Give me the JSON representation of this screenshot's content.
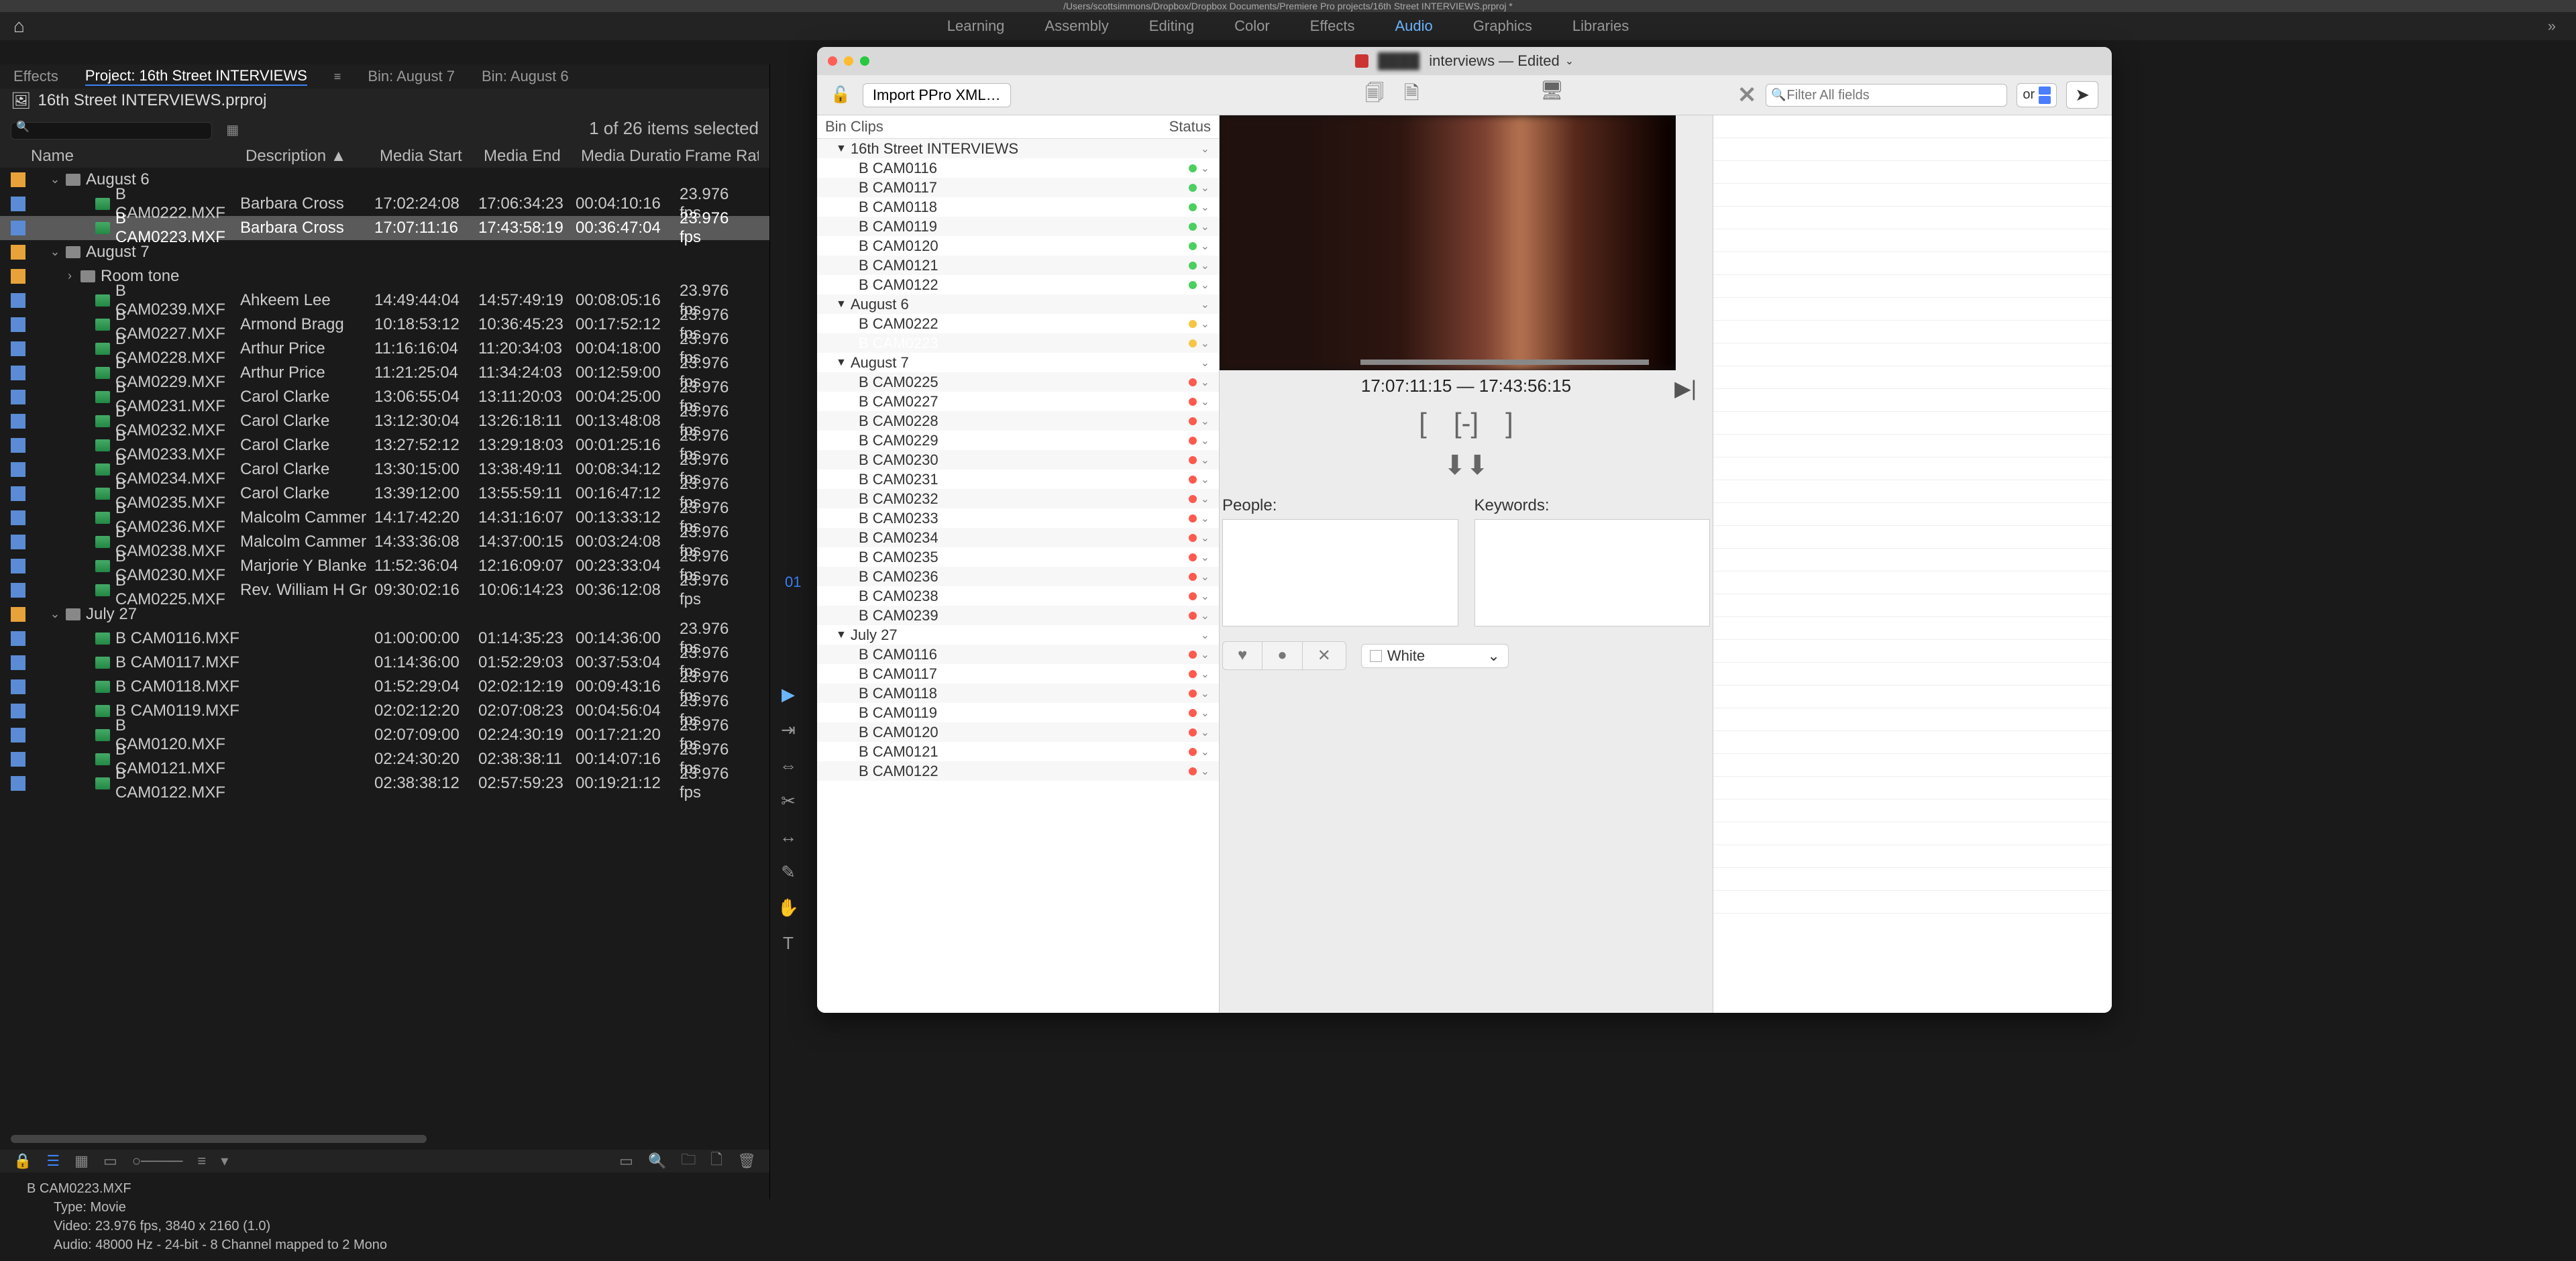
{
  "titlebar": "/Users/scottsimmons/Dropbox/Dropbox Documents/Premiere Pro projects/16th Street INTERVIEWS.prproj *",
  "workspaces": [
    "Learning",
    "Assembly",
    "Editing",
    "Color",
    "Effects",
    "Audio",
    "Graphics",
    "Libraries"
  ],
  "tabs": {
    "effects": "Effects",
    "project": "Project: 16th Street INTERVIEWS",
    "bin1": "Bin: August 7",
    "bin2": "Bin: August 6",
    "effR": "Effe"
  },
  "projectTitle": "16th Street INTERVIEWS.prproj",
  "selCount": "1 of 26 items selected",
  "columns": {
    "name": "Name",
    "desc": "Description ▲",
    "ms": "Media Start",
    "me": "Media End",
    "md": "Media Duratio",
    "fr": "Frame Rat"
  },
  "rows": [
    {
      "t": "folder",
      "ind": 1,
      "name": "August 6"
    },
    {
      "t": "clip",
      "ind": 3,
      "name": "B CAM0222.MXF",
      "desc": "Barbara Cross",
      "ms": "17:02:24:08",
      "me": "17:06:34:23",
      "md": "00:04:10:16",
      "fr": "23.976 fps"
    },
    {
      "t": "clip",
      "ind": 3,
      "name": "B CAM0223.MXF",
      "desc": "Barbara Cross",
      "ms": "17:07:11:16",
      "me": "17:43:58:19",
      "md": "00:36:47:04",
      "fr": "23.976 fps",
      "sel": true
    },
    {
      "t": "folder",
      "ind": 1,
      "name": "August 7"
    },
    {
      "t": "folder",
      "ind": 2,
      "name": "Room tone",
      "closed": true
    },
    {
      "t": "clip",
      "ind": 3,
      "name": "B CAM0239.MXF",
      "desc": "Ahkeem Lee",
      "ms": "14:49:44:04",
      "me": "14:57:49:19",
      "md": "00:08:05:16",
      "fr": "23.976 fps"
    },
    {
      "t": "clip",
      "ind": 3,
      "name": "B CAM0227.MXF",
      "desc": "Armond Bragg",
      "ms": "10:18:53:12",
      "me": "10:36:45:23",
      "md": "00:17:52:12",
      "fr": "23.976 fps"
    },
    {
      "t": "clip",
      "ind": 3,
      "name": "B CAM0228.MXF",
      "desc": "Arthur Price",
      "ms": "11:16:16:04",
      "me": "11:20:34:03",
      "md": "00:04:18:00",
      "fr": "23.976 fps"
    },
    {
      "t": "clip",
      "ind": 3,
      "name": "B CAM0229.MXF",
      "desc": "Arthur Price",
      "ms": "11:21:25:04",
      "me": "11:34:24:03",
      "md": "00:12:59:00",
      "fr": "23.976 fps"
    },
    {
      "t": "clip",
      "ind": 3,
      "name": "B CAM0231.MXF",
      "desc": "Carol Clarke",
      "ms": "13:06:55:04",
      "me": "13:11:20:03",
      "md": "00:04:25:00",
      "fr": "23.976 fps"
    },
    {
      "t": "clip",
      "ind": 3,
      "name": "B CAM0232.MXF",
      "desc": "Carol Clarke",
      "ms": "13:12:30:04",
      "me": "13:26:18:11",
      "md": "00:13:48:08",
      "fr": "23.976 fps"
    },
    {
      "t": "clip",
      "ind": 3,
      "name": "B CAM0233.MXF",
      "desc": "Carol Clarke",
      "ms": "13:27:52:12",
      "me": "13:29:18:03",
      "md": "00:01:25:16",
      "fr": "23.976 fps"
    },
    {
      "t": "clip",
      "ind": 3,
      "name": "B CAM0234.MXF",
      "desc": "Carol Clarke",
      "ms": "13:30:15:00",
      "me": "13:38:49:11",
      "md": "00:08:34:12",
      "fr": "23.976 fps"
    },
    {
      "t": "clip",
      "ind": 3,
      "name": "B CAM0235.MXF",
      "desc": "Carol Clarke",
      "ms": "13:39:12:00",
      "me": "13:55:59:11",
      "md": "00:16:47:12",
      "fr": "23.976 fps"
    },
    {
      "t": "clip",
      "ind": 3,
      "name": "B CAM0236.MXF",
      "desc": "Malcolm Cammer",
      "ms": "14:17:42:20",
      "me": "14:31:16:07",
      "md": "00:13:33:12",
      "fr": "23.976 fps"
    },
    {
      "t": "clip",
      "ind": 3,
      "name": "B CAM0238.MXF",
      "desc": "Malcolm Cammer",
      "ms": "14:33:36:08",
      "me": "14:37:00:15",
      "md": "00:03:24:08",
      "fr": "23.976 fps"
    },
    {
      "t": "clip",
      "ind": 3,
      "name": "B CAM0230.MXF",
      "desc": "Marjorie Y Blanke",
      "ms": "11:52:36:04",
      "me": "12:16:09:07",
      "md": "00:23:33:04",
      "fr": "23.976 fps"
    },
    {
      "t": "clip",
      "ind": 3,
      "name": "B CAM0225.MXF",
      "desc": "Rev. William H Gr",
      "ms": "09:30:02:16",
      "me": "10:06:14:23",
      "md": "00:36:12:08",
      "fr": "23.976 fps"
    },
    {
      "t": "folder",
      "ind": 1,
      "name": "July 27"
    },
    {
      "t": "clip",
      "ind": 3,
      "name": "B CAM0116.MXF",
      "desc": "",
      "ms": "01:00:00:00",
      "me": "01:14:35:23",
      "md": "00:14:36:00",
      "fr": "23.976 fps"
    },
    {
      "t": "clip",
      "ind": 3,
      "name": "B CAM0117.MXF",
      "desc": "",
      "ms": "01:14:36:00",
      "me": "01:52:29:03",
      "md": "00:37:53:04",
      "fr": "23.976 fps"
    },
    {
      "t": "clip",
      "ind": 3,
      "name": "B CAM0118.MXF",
      "desc": "",
      "ms": "01:52:29:04",
      "me": "02:02:12:19",
      "md": "00:09:43:16",
      "fr": "23.976 fps"
    },
    {
      "t": "clip",
      "ind": 3,
      "name": "B CAM0119.MXF",
      "desc": "",
      "ms": "02:02:12:20",
      "me": "02:07:08:23",
      "md": "00:04:56:04",
      "fr": "23.976 fps"
    },
    {
      "t": "clip",
      "ind": 3,
      "name": "B CAM0120.MXF",
      "desc": "",
      "ms": "02:07:09:00",
      "me": "02:24:30:19",
      "md": "00:17:21:20",
      "fr": "23.976 fps"
    },
    {
      "t": "clip",
      "ind": 3,
      "name": "B CAM0121.MXF",
      "desc": "",
      "ms": "02:24:30:20",
      "me": "02:38:38:11",
      "md": "00:14:07:16",
      "fr": "23.976 fps"
    },
    {
      "t": "clip",
      "ind": 3,
      "name": "B CAM0122.MXF",
      "desc": "",
      "ms": "02:38:38:12",
      "me": "02:57:59:23",
      "md": "00:19:21:12",
      "fr": "23.976 fps"
    }
  ],
  "meta": {
    "file": "B CAM0223.MXF",
    "type": "Type:  Movie",
    "video": "Video:  23.976 fps, 3840 x 2160 (1.0)",
    "audio": "Audio:  48000 Hz - 24-bit - 8 Channel mapped to 2 Mono"
  },
  "tlTimecode": "01",
  "overlay": {
    "title": "interviews — Edited",
    "importBtn": "Import PPro XML…",
    "searchPH": "Filter All fields",
    "or": "or",
    "listHdr": {
      "l": "Bin Clips",
      "r": "Status"
    },
    "tree": [
      {
        "t": "h",
        "label": "16th Street INTERVIEWS"
      },
      {
        "t": "c",
        "label": "B CAM0116",
        "dot": "g"
      },
      {
        "t": "c",
        "label": "B CAM0117",
        "dot": "g"
      },
      {
        "t": "c",
        "label": "B CAM0118",
        "dot": "g"
      },
      {
        "t": "c",
        "label": "B CAM0119",
        "dot": "g"
      },
      {
        "t": "c",
        "label": "B CAM0120",
        "dot": "g"
      },
      {
        "t": "c",
        "label": "B CAM0121",
        "dot": "g"
      },
      {
        "t": "c",
        "label": "B CAM0122",
        "dot": "g"
      },
      {
        "t": "h",
        "label": "August 6"
      },
      {
        "t": "c",
        "label": "B CAM0222",
        "dot": "y"
      },
      {
        "t": "c",
        "label": "B CAM0223",
        "dot": "y",
        "sel": true
      },
      {
        "t": "h",
        "label": "August 7"
      },
      {
        "t": "c",
        "label": "B CAM0225",
        "dot": "r"
      },
      {
        "t": "c",
        "label": "B CAM0227",
        "dot": "r"
      },
      {
        "t": "c",
        "label": "B CAM0228",
        "dot": "r"
      },
      {
        "t": "c",
        "label": "B CAM0229",
        "dot": "r"
      },
      {
        "t": "c",
        "label": "B CAM0230",
        "dot": "r"
      },
      {
        "t": "c",
        "label": "B CAM0231",
        "dot": "r"
      },
      {
        "t": "c",
        "label": "B CAM0232",
        "dot": "r"
      },
      {
        "t": "c",
        "label": "B CAM0233",
        "dot": "r"
      },
      {
        "t": "c",
        "label": "B CAM0234",
        "dot": "r"
      },
      {
        "t": "c",
        "label": "B CAM0235",
        "dot": "r"
      },
      {
        "t": "c",
        "label": "B CAM0236",
        "dot": "r"
      },
      {
        "t": "c",
        "label": "B CAM0238",
        "dot": "r"
      },
      {
        "t": "c",
        "label": "B CAM0239",
        "dot": "r"
      },
      {
        "t": "h",
        "label": "July 27"
      },
      {
        "t": "c",
        "label": "B CAM0116",
        "dot": "r"
      },
      {
        "t": "c",
        "label": "B CAM0117",
        "dot": "r"
      },
      {
        "t": "c",
        "label": "B CAM0118",
        "dot": "r"
      },
      {
        "t": "c",
        "label": "B CAM0119",
        "dot": "r"
      },
      {
        "t": "c",
        "label": "B CAM0120",
        "dot": "r"
      },
      {
        "t": "c",
        "label": "B CAM0121",
        "dot": "r"
      },
      {
        "t": "c",
        "label": "B CAM0122",
        "dot": "r"
      }
    ],
    "tc": "17:07:11:15 — 17:43:56:15",
    "people": "People:",
    "keywords": "Keywords:",
    "colorSel": "White"
  }
}
